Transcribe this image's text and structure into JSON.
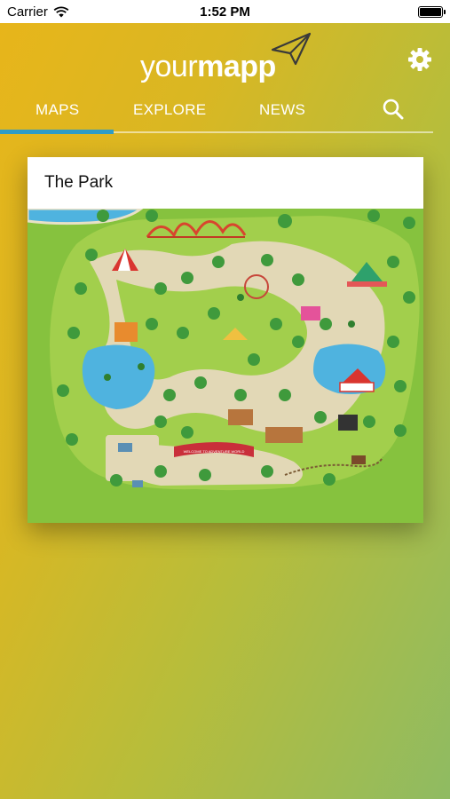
{
  "status_bar": {
    "carrier": "Carrier",
    "time": "1:52 PM",
    "battery_level": 1.0
  },
  "header": {
    "logo_light": "your",
    "logo_bold": "mapp",
    "settings_icon": "gear-icon",
    "logo_icon": "paper-plane-icon"
  },
  "tabs": {
    "items": [
      "MAPS",
      "EXPLORE",
      "NEWS"
    ],
    "active": "MAPS",
    "search_icon": "search-icon",
    "indicator_color": "#2e9cc6"
  },
  "maps": [
    {
      "title": "The Park",
      "banner_text": "WELCOME TO ADVENTURE WORLD"
    }
  ]
}
